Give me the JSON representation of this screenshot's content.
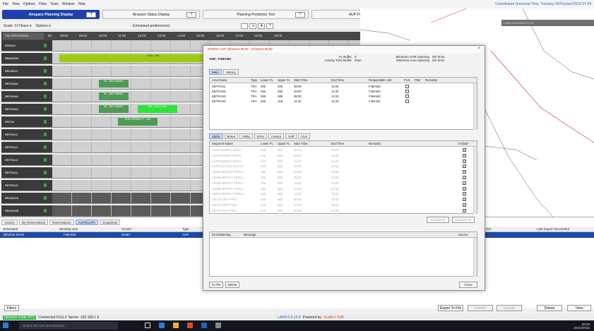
{
  "menubar": {
    "items": [
      "File",
      "View",
      "Options",
      "Filter",
      "Tools",
      "Window",
      "Help"
    ],
    "utc_clock": "Coordinated Universal Time: Tuesday 20/October/2015 07:49"
  },
  "tabs": [
    {
      "label": "Airspace Planning Display",
      "badge": "?"
    },
    {
      "label": "Airspace Status Display",
      "badge": "?"
    },
    {
      "label": "Planning Prediction Tool",
      "badge": "?"
    },
    {
      "label": "AUP Prediction Tool",
      "badge": "?"
    }
  ],
  "scalebar": {
    "scale": "Scale: 12 Hours ▾",
    "options": "Options ▾",
    "preferences": "(Unnamed preferences)"
  },
  "timeline": {
    "date": "Tue 20/Oct/2015",
    "times": [
      "06",
      "08:00",
      "09:00",
      "10:00",
      "11:00",
      "12:00",
      "13:00",
      "14:00",
      "15:00",
      "16:00",
      "17:00",
      "18:00",
      "19:00"
    ]
  },
  "rows": [
    {
      "label": "EDR302",
      "bars": []
    },
    {
      "label": "EBMAER1",
      "bars": [
        {
          "text": "GND - 285"
        }
      ]
    },
    {
      "label": "EBCB01C",
      "bars": []
    },
    {
      "label": "EBTRAN1",
      "bars": [
        {
          "text": "95 - 285 F4BAMC"
        }
      ]
    },
    {
      "label": "EBTRAN2",
      "bars": [
        {
          "text": "95 - 285 F4BAMC"
        }
      ]
    },
    {
      "label": "EBTRAN3",
      "bars": [
        {
          "text": "95 - 285 F4BAMC"
        },
        {
          "text": "095 - UNL LOOK"
        }
      ]
    },
    {
      "label": "EMT10",
      "bars": [
        {
          "text": "EGN DURING F1 - 445"
        }
      ]
    },
    {
      "label": "EBTRA11",
      "bars": []
    },
    {
      "label": "EBTRA12",
      "bars": []
    },
    {
      "label": "EBTRA13",
      "bars": []
    },
    {
      "label": "EBTRA14",
      "bars": []
    },
    {
      "label": "EBTRA15",
      "bars": []
    },
    {
      "label": "EBCBA2A",
      "bars": []
    },
    {
      "label": "EBCBA2B",
      "bars": []
    }
  ],
  "map": {
    "header": "LARA 20/10/2015 07:49"
  },
  "lower": {
    "subtabs": [
      "Actions",
      "My Reservations",
      "Reservations",
      "AUPs/UUPs",
      "Snapshots"
    ],
    "headers": [
      "Generated",
      "Sending Unit",
      "Cluster",
      "Type",
      "Hdr",
      "Last Export Successful"
    ],
    "row": [
      "19/10/15 09:29",
      "F4BAMC",
      "DUBA",
      "AUP"
    ],
    "buttons": {
      "filters": "Filters",
      "export": "Export To File",
      "publish": "Publish",
      "update": "Update",
      "delete": "Delete",
      "view": "View"
    }
  },
  "statusbar": {
    "network": "Network USite RTS",
    "connection": "Connected FULLY Server: 192.168.1.5",
    "version": "LARA 6.0.14.8",
    "powered_by": "Powered by",
    "sdk": "GroMco SDK"
  },
  "taskbar": {
    "search": "Search the web and Windows",
    "time": "09:49",
    "date": "20/10/2015"
  },
  "dialog": {
    "title": "INTENT AUP 20/10/15 06:00 - 21/10/15 06:00",
    "fl_buffer_label": "FL Buffer",
    "fl_buffer_value": "0",
    "activity_buffer_label": "Activity Time Buffer",
    "activity_buffer_value": "0min",
    "min_cdr_label": "Minimum CDR Opening",
    "min_cdr_value": "0hr 0min",
    "min_area_label": "Minimum Area Opening",
    "min_area_value": "0hr 0min",
    "amc": "AMC: F4BAMC",
    "top_subtabs": [
      "Main",
      "History"
    ],
    "area_headers": [
      "Area Name",
      "Type",
      "Lower FL",
      "Upper FL",
      "Start Time",
      "End Time",
      "Responsible Unit",
      "FUA",
      "FBZ",
      "Remarks"
    ],
    "area_rows": [
      [
        "EBTRAN1",
        "TRA",
        "095",
        "285",
        "08:00",
        "11:00",
        "F4BAMC"
      ],
      [
        "EBTRAN2",
        "TRA",
        "095",
        "285",
        "09:00",
        "11:00",
        "F4BAMC"
      ],
      [
        "EBTRAN2",
        "TRA",
        "095",
        "285",
        "08:00",
        "11:00",
        "F4BAMC"
      ],
      [
        "EBTRAN3",
        "TRA",
        "095",
        "UNL",
        "11:20",
        "13:20",
        "F4BAMC"
      ]
    ],
    "route_subtabs": [
      "Alpha",
      "Bravo",
      "Delta",
      "Echo",
      "Foxtrot",
      "Golf",
      "FUA"
    ],
    "route_headers": [
      "Segment Name",
      "Lower FL",
      "Upper FL",
      "Start Time",
      "End Time",
      "Remarks",
      "Include"
    ],
    "route_rows": [
      [
        "L0703 BABIN LERVO",
        "245",
        "660",
        "06:00",
        "08:00"
      ],
      [
        "L0703 BABIN LERVO",
        "245",
        "660",
        "08:00",
        "11:00"
      ],
      [
        "L0703 BABIN LERVO",
        "245",
        "660",
        "11:00",
        "22:00"
      ],
      [
        "L0703 BADOS DAGTU",
        "245",
        "660",
        "06:00",
        "22:00"
      ],
      [
        "UN852 BROGY TERLA",
        "195",
        "660",
        "06:00",
        "09:00"
      ],
      [
        "UN852 BROGY TERLA",
        "195",
        "660",
        "09:00",
        "11:00"
      ],
      [
        "UN852 BROGY TERLA",
        "195",
        "660",
        "11:00",
        "11:20"
      ],
      [
        "UN852 BROGY TERLA",
        "195",
        "660",
        "13:20",
        "22:00"
      ],
      [
        "UN852 BROGY TERLA",
        "195",
        "660",
        "11:20",
        "13:20"
      ],
      [
        "UN710 DIK PITES",
        "245",
        "660",
        "06:00",
        "22:00"
      ],
      [
        "UN710 DIK PITES",
        "245",
        "660",
        "22:00",
        "06:00"
      ],
      [
        "UN710 DIK PITES",
        "245",
        "660",
        "06:00",
        "22:00"
      ]
    ],
    "include_btn": "Include All",
    "exclude_btn": "Exclude All",
    "error_headers": [
      "Error/Warning",
      "Message",
      "Source"
    ],
    "tofile": "To File",
    "delete": "Delete",
    "close": "Close"
  }
}
